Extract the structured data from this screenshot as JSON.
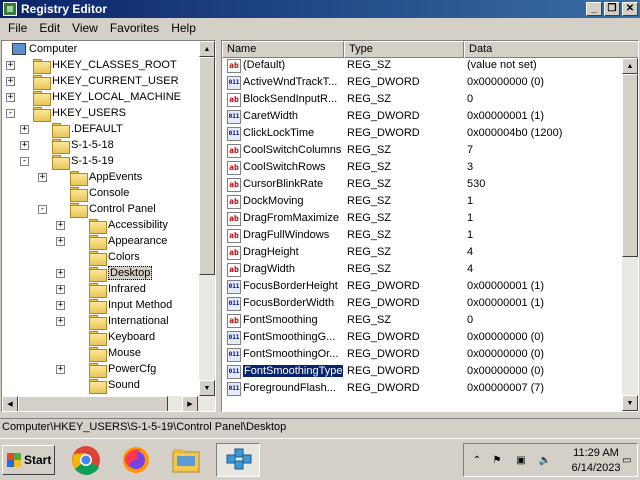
{
  "window": {
    "title": "Registry Editor"
  },
  "menu": [
    "File",
    "Edit",
    "View",
    "Favorites",
    "Help"
  ],
  "tree": [
    {
      "label": "Computer",
      "icon": "computer-icon",
      "expander": ""
    },
    {
      "label": "HKEY_CLASSES_ROOT",
      "expander": "+"
    },
    {
      "label": "HKEY_CURRENT_USER",
      "expander": "+"
    },
    {
      "label": "HKEY_LOCAL_MACHINE",
      "expander": "+"
    },
    {
      "label": "HKEY_USERS",
      "expander": "-"
    },
    {
      "label": ".DEFAULT",
      "expander": "+"
    },
    {
      "label": "S-1-5-18",
      "expander": "+"
    },
    {
      "label": "S-1-5-19",
      "expander": "-"
    },
    {
      "label": "AppEvents",
      "expander": "+"
    },
    {
      "label": "Console",
      "expander": ""
    },
    {
      "label": "Control Panel",
      "expander": "-"
    },
    {
      "label": "Accessibility",
      "expander": "+"
    },
    {
      "label": "Appearance",
      "expander": "+"
    },
    {
      "label": "Colors",
      "expander": ""
    },
    {
      "label": "Desktop",
      "expander": "+",
      "selected": true
    },
    {
      "label": "Infrared",
      "expander": "+"
    },
    {
      "label": "Input Method",
      "expander": "+"
    },
    {
      "label": "International",
      "expander": "+"
    },
    {
      "label": "Keyboard",
      "expander": ""
    },
    {
      "label": "Mouse",
      "expander": ""
    },
    {
      "label": "PowerCfg",
      "expander": "+"
    },
    {
      "label": "Sound",
      "expander": ""
    }
  ],
  "columns": {
    "name": "Name",
    "type": "Type",
    "data": "Data"
  },
  "values": [
    {
      "name": "(Default)",
      "type": "REG_SZ",
      "data": "(value not set)",
      "kind": "sz"
    },
    {
      "name": "ActiveWndTrackT...",
      "type": "REG_DWORD",
      "data": "0x00000000 (0)",
      "kind": "dword"
    },
    {
      "name": "BlockSendInputR...",
      "type": "REG_SZ",
      "data": "0",
      "kind": "sz"
    },
    {
      "name": "CaretWidth",
      "type": "REG_DWORD",
      "data": "0x00000001 (1)",
      "kind": "dword"
    },
    {
      "name": "ClickLockTime",
      "type": "REG_DWORD",
      "data": "0x000004b0 (1200)",
      "kind": "dword"
    },
    {
      "name": "CoolSwitchColumns",
      "type": "REG_SZ",
      "data": "7",
      "kind": "sz"
    },
    {
      "name": "CoolSwitchRows",
      "type": "REG_SZ",
      "data": "3",
      "kind": "sz"
    },
    {
      "name": "CursorBlinkRate",
      "type": "REG_SZ",
      "data": "530",
      "kind": "sz"
    },
    {
      "name": "DockMoving",
      "type": "REG_SZ",
      "data": "1",
      "kind": "sz"
    },
    {
      "name": "DragFromMaximize",
      "type": "REG_SZ",
      "data": "1",
      "kind": "sz"
    },
    {
      "name": "DragFullWindows",
      "type": "REG_SZ",
      "data": "1",
      "kind": "sz"
    },
    {
      "name": "DragHeight",
      "type": "REG_SZ",
      "data": "4",
      "kind": "sz"
    },
    {
      "name": "DragWidth",
      "type": "REG_SZ",
      "data": "4",
      "kind": "sz"
    },
    {
      "name": "FocusBorderHeight",
      "type": "REG_DWORD",
      "data": "0x00000001 (1)",
      "kind": "dword"
    },
    {
      "name": "FocusBorderWidth",
      "type": "REG_DWORD",
      "data": "0x00000001 (1)",
      "kind": "dword"
    },
    {
      "name": "FontSmoothing",
      "type": "REG_SZ",
      "data": "0",
      "kind": "sz"
    },
    {
      "name": "FontSmoothingG...",
      "type": "REG_DWORD",
      "data": "0x00000000 (0)",
      "kind": "dword"
    },
    {
      "name": "FontSmoothingOr...",
      "type": "REG_DWORD",
      "data": "0x00000000 (0)",
      "kind": "dword"
    },
    {
      "name": "FontSmoothingType",
      "type": "REG_DWORD",
      "data": "0x00000000 (0)",
      "kind": "dword",
      "selected": true
    },
    {
      "name": "ForegroundFlash...",
      "type": "REG_DWORD",
      "data": "0x00000007 (7)",
      "kind": "dword"
    }
  ],
  "statusbar": {
    "path": "Computer\\HKEY_USERS\\S-1-5-19\\Control Panel\\Desktop"
  },
  "taskbar": {
    "start_label": "Start",
    "apps": [
      "chrome-icon",
      "firefox-icon",
      "file-explorer-icon",
      "registry-editor-icon"
    ],
    "clock_time": "11:29 AM",
    "clock_date": "6/14/2023"
  }
}
